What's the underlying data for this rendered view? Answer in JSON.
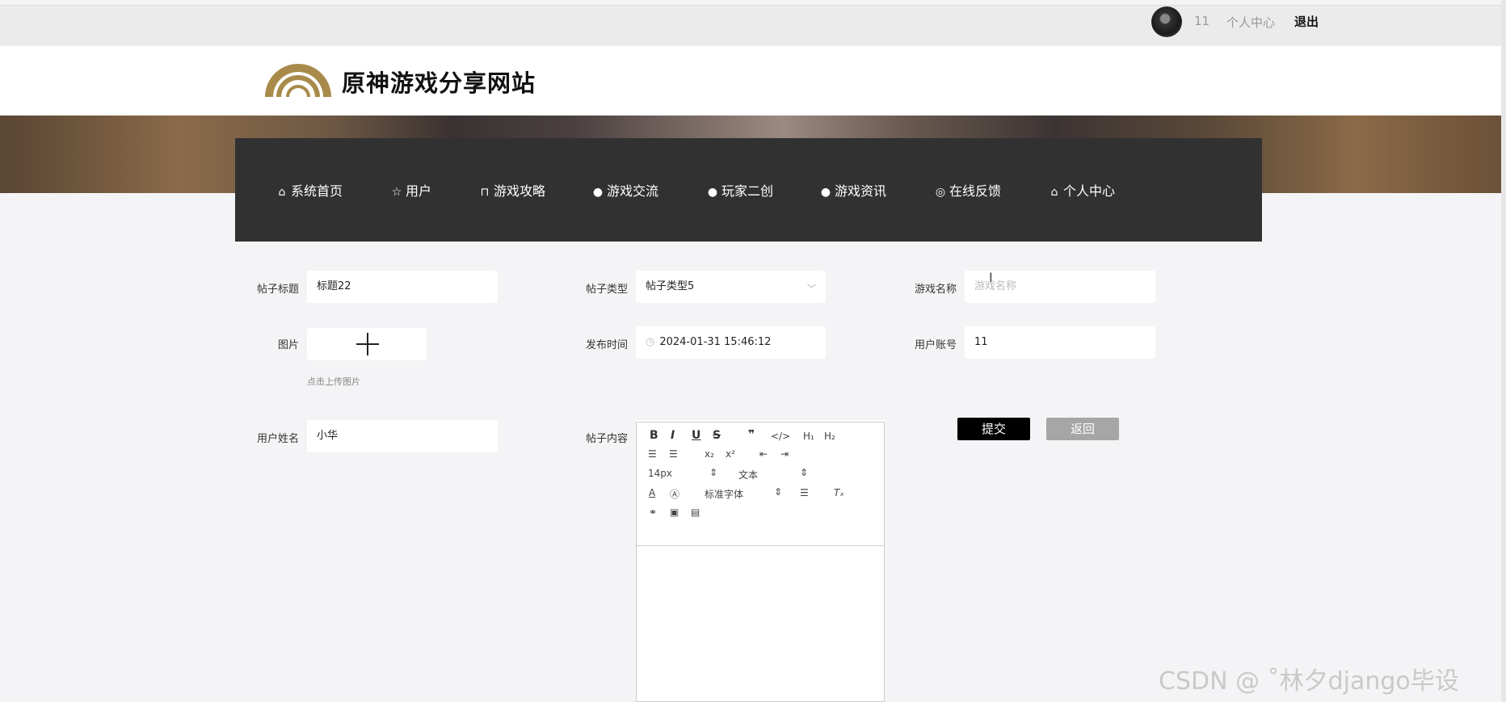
{
  "topbar": {
    "username": "11",
    "personal_center": "个人中心",
    "logout": "退出"
  },
  "header": {
    "site_title": "原神游戏分享网站",
    "brand_color": "#a88a4a"
  },
  "nav": {
    "items": [
      {
        "icon": "home-icon",
        "label": "系统首页"
      },
      {
        "icon": "star-icon",
        "label": "用户"
      },
      {
        "icon": "bag-icon",
        "label": "游戏攻略"
      },
      {
        "icon": "alert-icon",
        "label": "游戏交流"
      },
      {
        "icon": "question-icon",
        "label": "玩家二创"
      },
      {
        "icon": "info-icon",
        "label": "游戏资讯"
      },
      {
        "icon": "help-circle-icon",
        "label": "在线反馈"
      },
      {
        "icon": "home-icon",
        "label": "个人中心"
      }
    ]
  },
  "form": {
    "title_label": "帖子标题",
    "title_value": "标题22",
    "type_label": "帖子类型",
    "type_value": "帖子类型5",
    "game_label": "游戏名称",
    "game_placeholder": "游戏名称",
    "image_label": "图片",
    "upload_hint": "点击上传图片",
    "time_label": "发布时间",
    "time_value": "2024-01-31 15:46:12",
    "account_label": "用户账号",
    "account_value": "11",
    "name_label": "用户姓名",
    "name_value": "小华",
    "content_label": "帖子内容",
    "submit": "提交",
    "back": "返回"
  },
  "editor": {
    "font_size": "14px",
    "block_type": "文本",
    "font_family": "标准字体",
    "buttons": [
      "B",
      "I",
      "U",
      "S",
      "”",
      "</>",
      "H1",
      "H2",
      "ordered-list",
      "bullet-list",
      "X2",
      "X2",
      "outdent",
      "indent",
      "text-color",
      "bg-color",
      "align",
      "clean",
      "link",
      "image",
      "video"
    ]
  },
  "watermark": "CSDN @ ˚林夕django毕设"
}
